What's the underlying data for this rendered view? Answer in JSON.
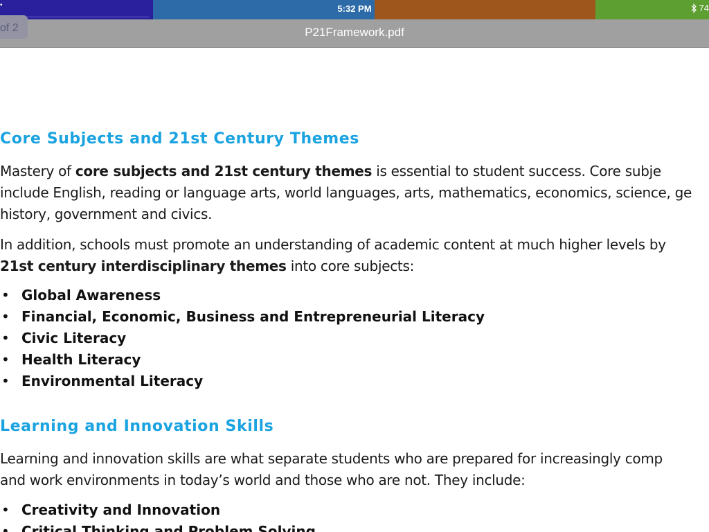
{
  "status": {
    "left_glyph": "•",
    "time": "5:32 PM",
    "battery": "74"
  },
  "toolbar": {
    "page_indicator": "of 2",
    "title": "P21Framework.pdf"
  },
  "document": {
    "heading1": "Core Subjects and 21st Century Themes",
    "para1": {
      "line1_a": "Mastery of ",
      "line1_b": "core subjects and 21st century themes",
      "line1_c": " is essential to student success. Core subje",
      "line2": "include English, reading or language arts, world languages, arts, mathematics, economics, science, ge",
      "line3": "history, government and civics."
    },
    "para2": {
      "line1": "In addition, schools must promote an understanding of academic content at much higher levels by",
      "line2_a": "21st century interdisciplinary themes",
      "line2_b": " into core subjects:"
    },
    "bullets1": [
      "Global Awareness",
      "Financial, Economic, Business and Entrepreneurial Literacy",
      "Civic Literacy",
      "Health Literacy",
      "Environmental Literacy"
    ],
    "heading2": "Learning and Innovation Skills",
    "para3": {
      "line1": "Learning and innovation skills are what separate students who are prepared for increasingly comp",
      "line2": "and work environments in today’s world and those who are not. They include:"
    },
    "bullets2": [
      "Creativity and Innovation",
      "Critical Thinking and Problem Solving"
    ],
    "bullet_glyph": "•"
  }
}
